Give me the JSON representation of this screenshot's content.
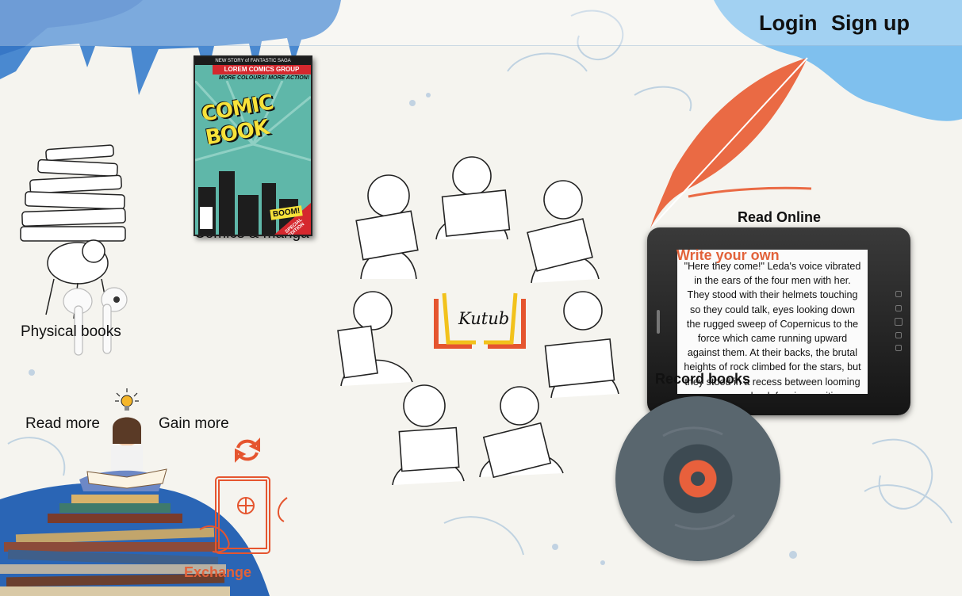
{
  "nav": {
    "login_label": "Login",
    "signup_label": "Sign up"
  },
  "brand": {
    "logo_text": "Kutub"
  },
  "categories": {
    "physical_books": "Physical books",
    "comics_manga": "Comics & manga",
    "read_online": "Read Online",
    "write_your_own": "Write your own",
    "record_books": "Record books",
    "read_more": "Read more",
    "gain_more": "Gain more",
    "exchange": "Exchange"
  },
  "comic_cover": {
    "top_line": "NEW STORY of FANTASTIC SAGA",
    "band": "LOREM COMICS GROUP",
    "tagline": "MORE COLOURS! MORE ACTION!",
    "title": "COMIC BOOK",
    "boom": "BOOM!",
    "corner": "SPECIAL EDITION"
  },
  "ebook_excerpt": "\"Here they come!\" Leda's voice vibrated in the ears of the four men with her. They stood with their helmets touching so they could talk, eyes looking down the rugged sweep of Copernicus to the force which came running upward against them. At their backs, the brutal heights of rock climbed for the stars, but they stood in a recess between looming crags, as good a defensive position as they could hope for. \"Fight it out!\" Pihard signaled.",
  "colors": {
    "accent_orange": "#e2623a",
    "accent_blue": "#2a65b5",
    "background": "#f5f4ef"
  },
  "icons": [
    "books-stack-icon",
    "earbuds-icon",
    "lightbulb-icon",
    "refresh-arrows-icon",
    "book-exchange-icon",
    "feather-quill-icon",
    "vinyl-record-icon"
  ]
}
